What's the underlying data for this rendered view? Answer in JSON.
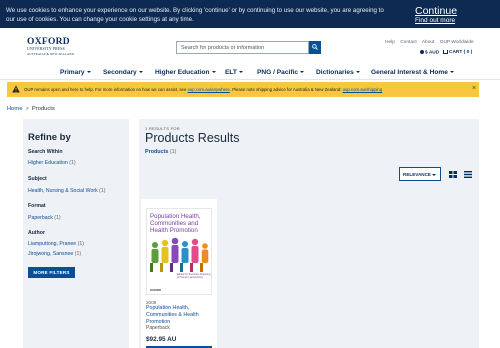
{
  "cookie": {
    "text": "We use cookies to enhance your experience on our website. By clicking 'continue' or by continuing to use our website, you are agreeing to our use of cookies. You can change your cookie settings at any time.",
    "continue_label": "Continue",
    "find_out_label": "Find out more"
  },
  "header": {
    "logo_main": "OXFORD",
    "logo_sub1": "UNIVERSITY PRESS",
    "logo_sub2": "AUSTRALIA & NEW ZEALAND",
    "search_placeholder": "Search for products or information",
    "top_links": [
      "Help",
      "Contact",
      "About",
      "OUP Worldwide"
    ],
    "currency": "$ AUD",
    "cart": "CART ( 0 )"
  },
  "nav": {
    "items": [
      "Primary",
      "Secondary",
      "Higher Education",
      "ELT",
      "PNG / Pacific",
      "Dictionaries",
      "General Interest & Home"
    ]
  },
  "notice": {
    "text": "OUP remains open and here to help. For more information on how we can assist, see ",
    "link1": "oup.com.au/anywhere",
    "text2": ". Please note shipping advice for Australia & New Zealand: ",
    "link2": "oup.com.au/shipping",
    "close": "×"
  },
  "breadcrumb": {
    "home": "Home",
    "sep": ">",
    "current": "Products"
  },
  "refine": {
    "title": "Refine by",
    "facets": [
      {
        "title": "Search Within",
        "items": [
          {
            "label": "Higher Education",
            "count": "(1)"
          }
        ]
      },
      {
        "title": "Subject",
        "items": [
          {
            "label": "Health, Nursing & Social Work",
            "count": "(1)"
          }
        ]
      },
      {
        "title": "Format",
        "items": [
          {
            "label": "Paperback",
            "count": "(1)"
          }
        ]
      },
      {
        "title": "Author",
        "items": [
          {
            "label": "Liamputtong, Pranee",
            "count": "(1)"
          },
          {
            "label": "Jirojwong, Sansnee",
            "count": "(1)"
          }
        ]
      }
    ],
    "more_filters": "MORE FILTERS"
  },
  "results": {
    "count": "1 RESULTS FOR",
    "title": "Products Results",
    "sub_label": "Products",
    "sub_count": "(1)",
    "sort": "RELEVANCE"
  },
  "product": {
    "cover_title": "Population Health, Communities and Health Promotion",
    "cover_foot": "Edited by Sansnee Jirojwong & Pranee Liamputtong",
    "cover_logo": "OXFORD",
    "year": "2008",
    "title": "Population Health, Communities & Health Promotion",
    "format": "Paperback",
    "price": "$92.95 AU"
  },
  "colors": {
    "cookie_bg": "#0d2a52",
    "brand": "#0a2c5f",
    "link": "#0a4e96",
    "notice_bg": "#f9c640",
    "panel_bg": "#eef1f5"
  }
}
